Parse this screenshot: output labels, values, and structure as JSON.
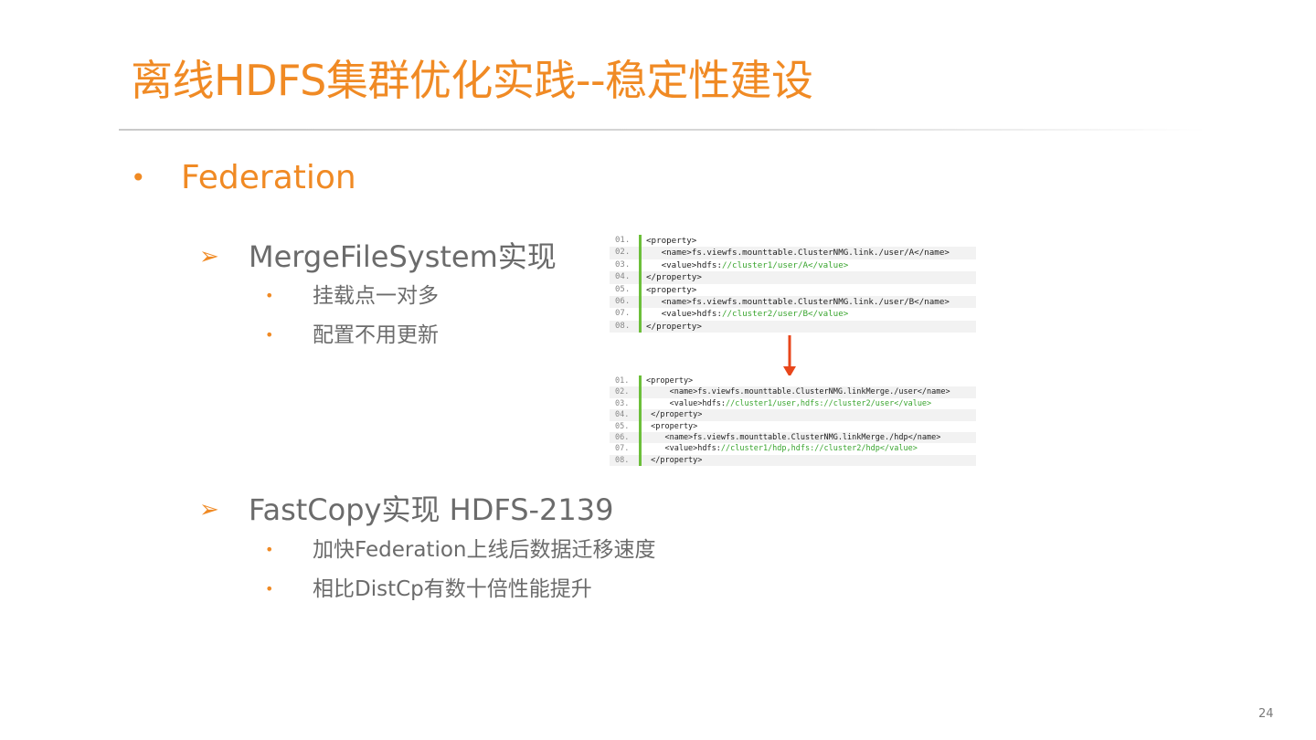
{
  "slide": {
    "title": "离线HDFS集群优化实践--稳定性建设",
    "page_number": "24",
    "accent_color": "#F08A24",
    "bullet": {
      "symbol": "•",
      "text": "Federation"
    },
    "sections": [
      {
        "arrow": "➢",
        "heading": "MergeFileSystem实现",
        "items": [
          {
            "dot": "•",
            "text": "挂载点一对多"
          },
          {
            "dot": "•",
            "text": "配置不用更新"
          }
        ]
      },
      {
        "arrow": "➢",
        "heading": "FastCopy实现 HDFS-2139",
        "items": [
          {
            "dot": "•",
            "text": "加快Federation上线后数据迁移速度"
          },
          {
            "dot": "•",
            "text": "相比DistCp有数十倍性能提升"
          }
        ]
      }
    ],
    "code_before": {
      "line_numbers": [
        "01.",
        "02.",
        "03.",
        "04.",
        "05.",
        "06.",
        "07.",
        "08."
      ],
      "lines": [
        {
          "plain": "<property>",
          "green": "",
          "tail": ""
        },
        {
          "plain": "   <name>fs.viewfs.mounttable.ClusterNMG.link./user/A</name>",
          "green": "",
          "tail": ""
        },
        {
          "plain": "   <value>hdfs:",
          "green": "//cluster1/user/A</value>",
          "tail": ""
        },
        {
          "plain": "</property>",
          "green": "",
          "tail": ""
        },
        {
          "plain": "<property>",
          "green": "",
          "tail": ""
        },
        {
          "plain": "   <name>fs.viewfs.mounttable.ClusterNMG.link./user/B</name>",
          "green": "",
          "tail": ""
        },
        {
          "plain": "   <value>hdfs:",
          "green": "//cluster2/user/B</value>",
          "tail": ""
        },
        {
          "plain": "</property>",
          "green": "",
          "tail": ""
        }
      ]
    },
    "code_after": {
      "line_numbers": [
        "01.",
        "02.",
        "03.",
        "04.",
        "05.",
        "06.",
        "07.",
        "08."
      ],
      "lines": [
        {
          "plain": "<property>",
          "green": "",
          "tail": ""
        },
        {
          "plain": "     <name>fs.viewfs.mounttable.ClusterNMG.linkMerge./user</name>",
          "green": "",
          "tail": ""
        },
        {
          "plain": "     <value>hdfs:",
          "green": "//cluster1/user,hdfs://cluster2/user</value>",
          "tail": ""
        },
        {
          "plain": " </property>",
          "green": "",
          "tail": ""
        },
        {
          "plain": " <property>",
          "green": "",
          "tail": ""
        },
        {
          "plain": "    <name>fs.viewfs.mounttable.ClusterNMG.linkMerge./hdp</name>",
          "green": "",
          "tail": ""
        },
        {
          "plain": "    <value>hdfs:",
          "green": "//cluster1/hdp,hdfs://cluster2/hdp</value>",
          "tail": ""
        },
        {
          "plain": " </property>",
          "green": "",
          "tail": ""
        }
      ]
    }
  }
}
